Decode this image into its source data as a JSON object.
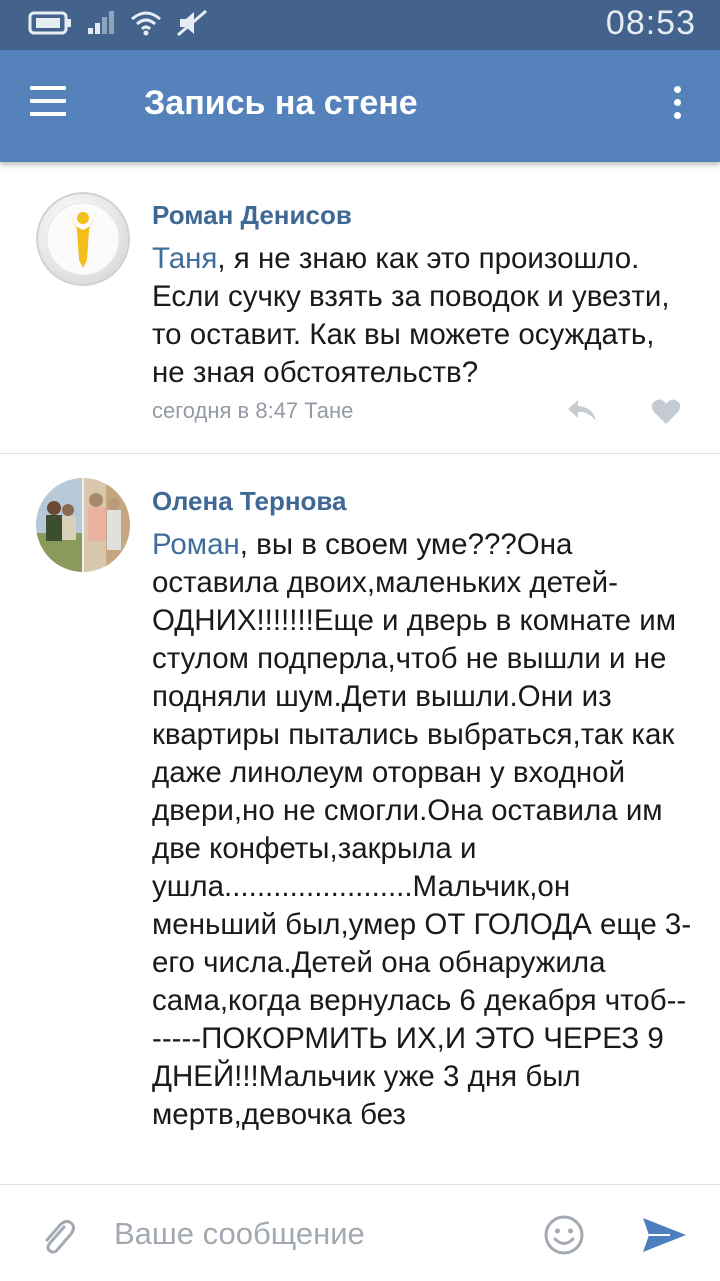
{
  "status_bar": {
    "time": "08:53"
  },
  "header": {
    "title": "Запись на стене"
  },
  "comments": [
    {
      "author": "Роман Денисов",
      "mention": "Таня",
      "text": ", я не знаю как это произошло. Если сучку взять за поводок и увезти, то оставит. Как вы можете осуждать, не зная обстоятельств?",
      "meta": "сегодня в 8:47 Тане"
    },
    {
      "author": "Олена Тернова",
      "mention": "Роман",
      "text": ", вы в своем уме???Она оставила двоих,маленьких детей-ОДНИХ!!!!!!!Еще и дверь в комнате им стулом подперла,чтоб не вышли и не подняли шум.Дети вышли.Они из квартиры пытались выбраться,так как даже линолеум оторван у входной двери,но не смогли.Она оставила им две конфеты,закрыла и ушла.......................Мальчик,он меньший был,умер ОТ ГОЛОДА еще 3-его числа.Детей она обнаружила сама,когда вернулась 6 декабря чтоб-------ПОКОРМИТЬ ИХ,И ЭТО ЧЕРЕЗ 9 ДНЕЙ!!!Мальчик уже 3 дня был мертв,девочка без"
    }
  ],
  "composer": {
    "placeholder": "Ваше сообщение"
  }
}
